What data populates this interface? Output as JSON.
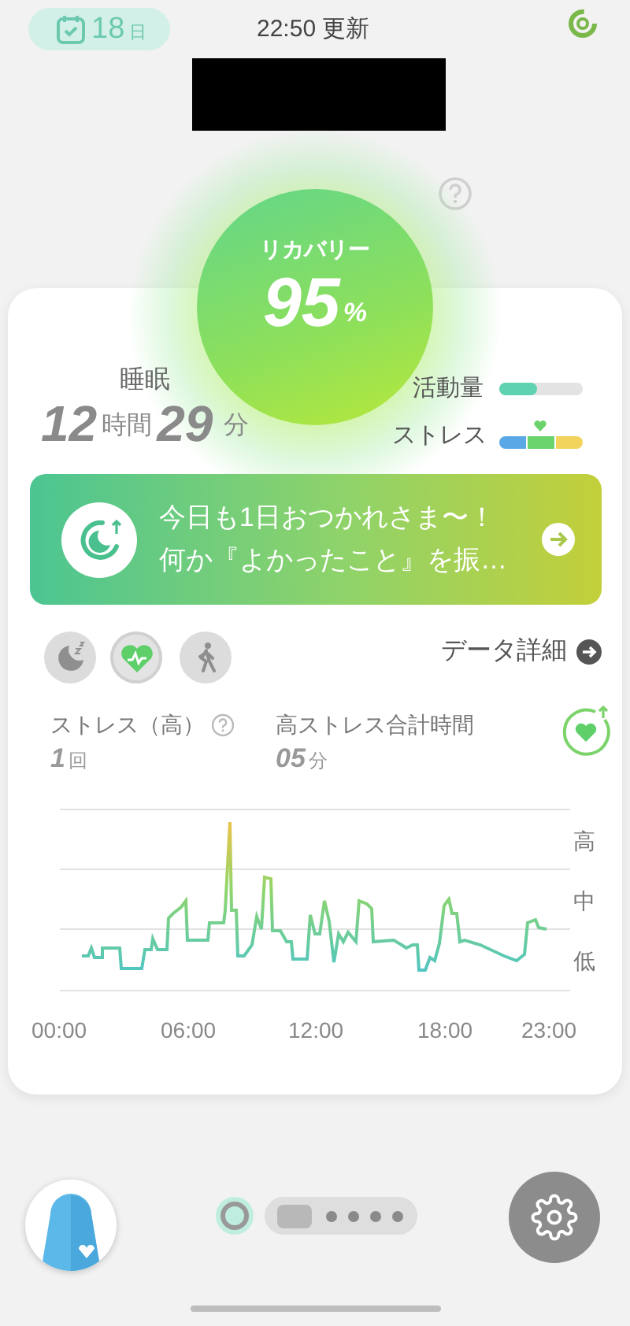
{
  "header": {
    "date_day": "18",
    "date_unit": "日",
    "updated": "22:50 更新"
  },
  "recovery": {
    "label": "リカバリー",
    "value": "95",
    "unit": "%"
  },
  "sleep": {
    "label": "睡眠",
    "hours": "12",
    "hours_unit": "時間",
    "minutes": "29",
    "minutes_unit": "分"
  },
  "activity": {
    "label": "活動量",
    "level": 0.45
  },
  "stress_meter": {
    "label": "ストレス"
  },
  "banner": {
    "lines": [
      "今日も1日おつかれさま〜！",
      "何か『よかったこと』を振…"
    ]
  },
  "tabs": [
    {
      "kind": "sleep",
      "selected": false
    },
    {
      "kind": "heart",
      "selected": true
    },
    {
      "kind": "walk",
      "selected": false
    }
  ],
  "details_link": "データ詳細",
  "stats": [
    {
      "label": "ストレス（高）",
      "value": "1",
      "unit": "回",
      "help": true
    },
    {
      "label": "高ストレス合計時間",
      "value": "05",
      "unit": "分",
      "help": false
    }
  ],
  "chart": {
    "y_labels": [
      "高",
      "中",
      "低"
    ],
    "x_labels": [
      "00:00",
      "06:00",
      "12:00",
      "18:00",
      "23:00"
    ]
  },
  "pager": {
    "pages": [
      {
        "selected": true
      },
      {
        "selected": false
      },
      {
        "selected": false
      },
      {
        "selected": false
      },
      {
        "selected": false
      }
    ]
  }
}
